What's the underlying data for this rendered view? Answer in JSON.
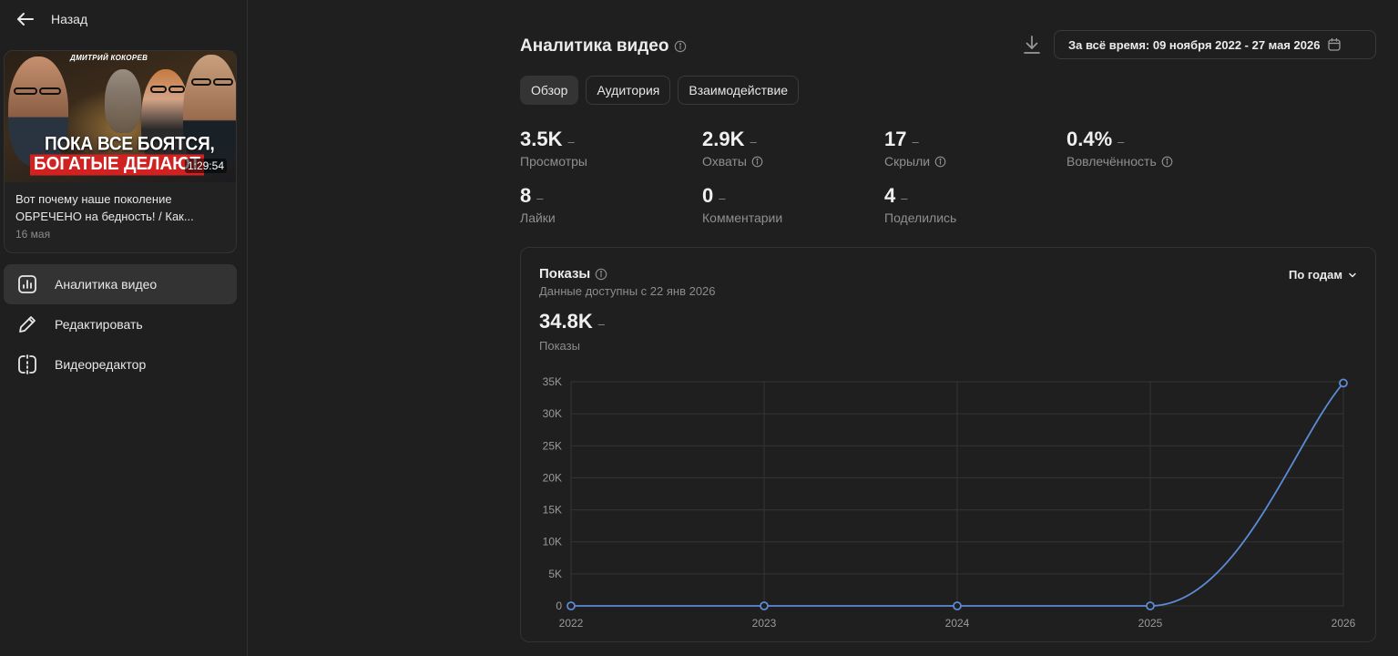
{
  "sidebar": {
    "back_label": "Назад",
    "video": {
      "thumbnail_author": "ДМИТРИЙ КОКОРЕВ",
      "thumbnail_line1": "ПОКА ВСЕ БОЯТСЯ,",
      "thumbnail_line2": "БОГАТЫЕ ДЕЛАЮТ",
      "duration": "1:29:54",
      "title": "Вот почему наше поколение ОБРЕЧЕНО на бедность! / Как...",
      "date": "16 мая"
    },
    "nav": [
      {
        "label": "Аналитика видео",
        "icon": "analytics-icon",
        "active": true
      },
      {
        "label": "Редактировать",
        "icon": "pencil-icon",
        "active": false
      },
      {
        "label": "Видеоредактор",
        "icon": "video-editor-icon",
        "active": false
      }
    ]
  },
  "header": {
    "title": "Аналитика видео",
    "date_range": "За всё время: 09 ноября 2022 - 27 мая 2026"
  },
  "tabs": [
    "Обзор",
    "Аудитория",
    "Взаимодействие"
  ],
  "metrics": [
    {
      "value": "3.5K",
      "label": "Просмотры",
      "info": false
    },
    {
      "value": "2.9K",
      "label": "Охваты",
      "info": true
    },
    {
      "value": "17",
      "label": "Скрыли",
      "info": true
    },
    {
      "value": "0.4%",
      "label": "Вовлечённость",
      "info": true
    },
    {
      "value": "8",
      "label": "Лайки",
      "info": false
    },
    {
      "value": "0",
      "label": "Комментарии",
      "info": false
    },
    {
      "value": "4",
      "label": "Поделились",
      "info": false
    }
  ],
  "chart_card": {
    "title": "Показы",
    "subtitle": "Данные доступны с 22 янв 2026",
    "period": "По годам",
    "total_value": "34.8K",
    "total_label": "Показы",
    "dash": "–"
  },
  "chart_data": {
    "type": "line",
    "x": [
      "2022",
      "2023",
      "2024",
      "2025",
      "2026"
    ],
    "series": [
      {
        "values": [
          0,
          0,
          0,
          0,
          34800
        ]
      }
    ],
    "ylim": [
      0,
      35000
    ],
    "yticks": [
      0,
      5000,
      10000,
      15000,
      20000,
      25000,
      30000,
      35000
    ],
    "ytick_labels": [
      "0",
      "5K",
      "10K",
      "15K",
      "20K",
      "25K",
      "30K",
      "35K"
    ],
    "grid": true,
    "color": "#5b8bd6"
  }
}
